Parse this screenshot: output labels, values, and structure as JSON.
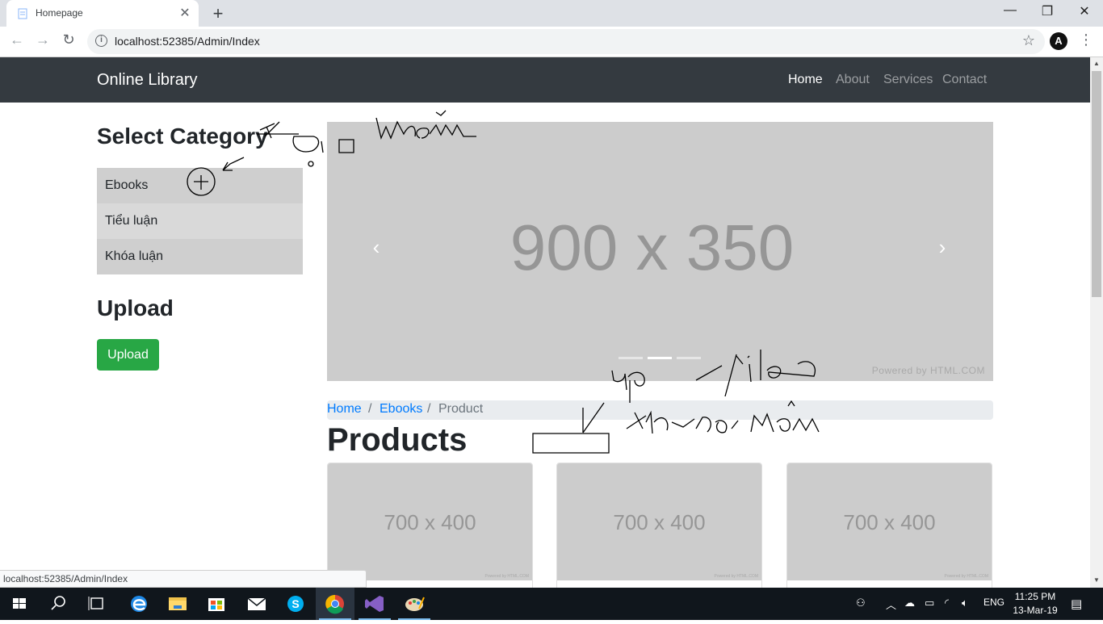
{
  "browser": {
    "tab_title": "Homepage",
    "new_tab_symbol": "+",
    "url": "localhost:52385/Admin/Index",
    "status_url": "localhost:52385/Admin/Index"
  },
  "site": {
    "brand": "Online Library",
    "nav": [
      {
        "label": "Home",
        "active": true
      },
      {
        "label": "About",
        "active": false
      },
      {
        "label": "Services",
        "active": false
      },
      {
        "label": "Contact",
        "active": false
      }
    ]
  },
  "sidebar": {
    "category_heading": "Select Category",
    "categories": [
      "Ebooks",
      "Tiểu luận",
      "Khóa luận"
    ],
    "upload_heading": "Upload",
    "upload_button": "Upload"
  },
  "carousel": {
    "placeholder": "900 x 350",
    "powered_by": "Powered by HTML.COM",
    "slide_count": 3,
    "active_slide": 2
  },
  "breadcrumb": {
    "items": [
      "Home",
      "Ebooks",
      "Product"
    ],
    "separator": "/"
  },
  "products": {
    "title": "Products",
    "cards": [
      {
        "placeholder": "700 x 400",
        "powered_by": "Powered by HTML.COM"
      },
      {
        "placeholder": "700 x 400",
        "powered_by": "Powered by HTML.COM"
      },
      {
        "placeholder": "700 x 400",
        "powered_by": "Powered by HTML.COM"
      }
    ]
  },
  "taskbar": {
    "language": "ENG",
    "time": "11:25 PM",
    "date": "13-Mar-19"
  },
  "colors": {
    "navbar": "#343a40",
    "upload_button": "#28a745",
    "link": "#007bff",
    "placeholder_bg": "#cccccc",
    "taskbar": "#10161c"
  }
}
